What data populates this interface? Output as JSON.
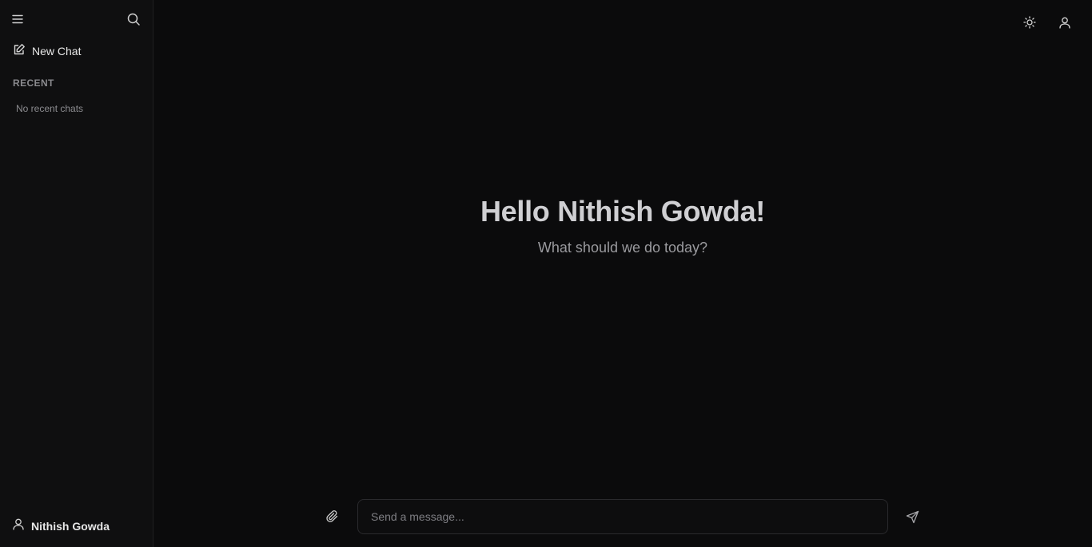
{
  "sidebar": {
    "menu_icon": "menu-icon",
    "search_icon": "search-icon",
    "new_chat_label": "New Chat",
    "recent_label": "RECENT",
    "empty_recent": "No recent chats",
    "user_name": "Nithish Gowda"
  },
  "topbar": {
    "theme_icon": "sun-icon",
    "profile_icon": "user-icon"
  },
  "main": {
    "greeting_title": "Hello Nithish Gowda!",
    "greeting_subtitle": "What should we do today?"
  },
  "composer": {
    "placeholder": "Send a message...",
    "attach_icon": "paperclip-icon",
    "send_icon": "send-icon"
  },
  "colors": {
    "background": "#0b0b0c",
    "sidebar_background": "#0f0f10",
    "text_primary": "#e6e6e6",
    "text_muted": "#8a8a8e"
  }
}
